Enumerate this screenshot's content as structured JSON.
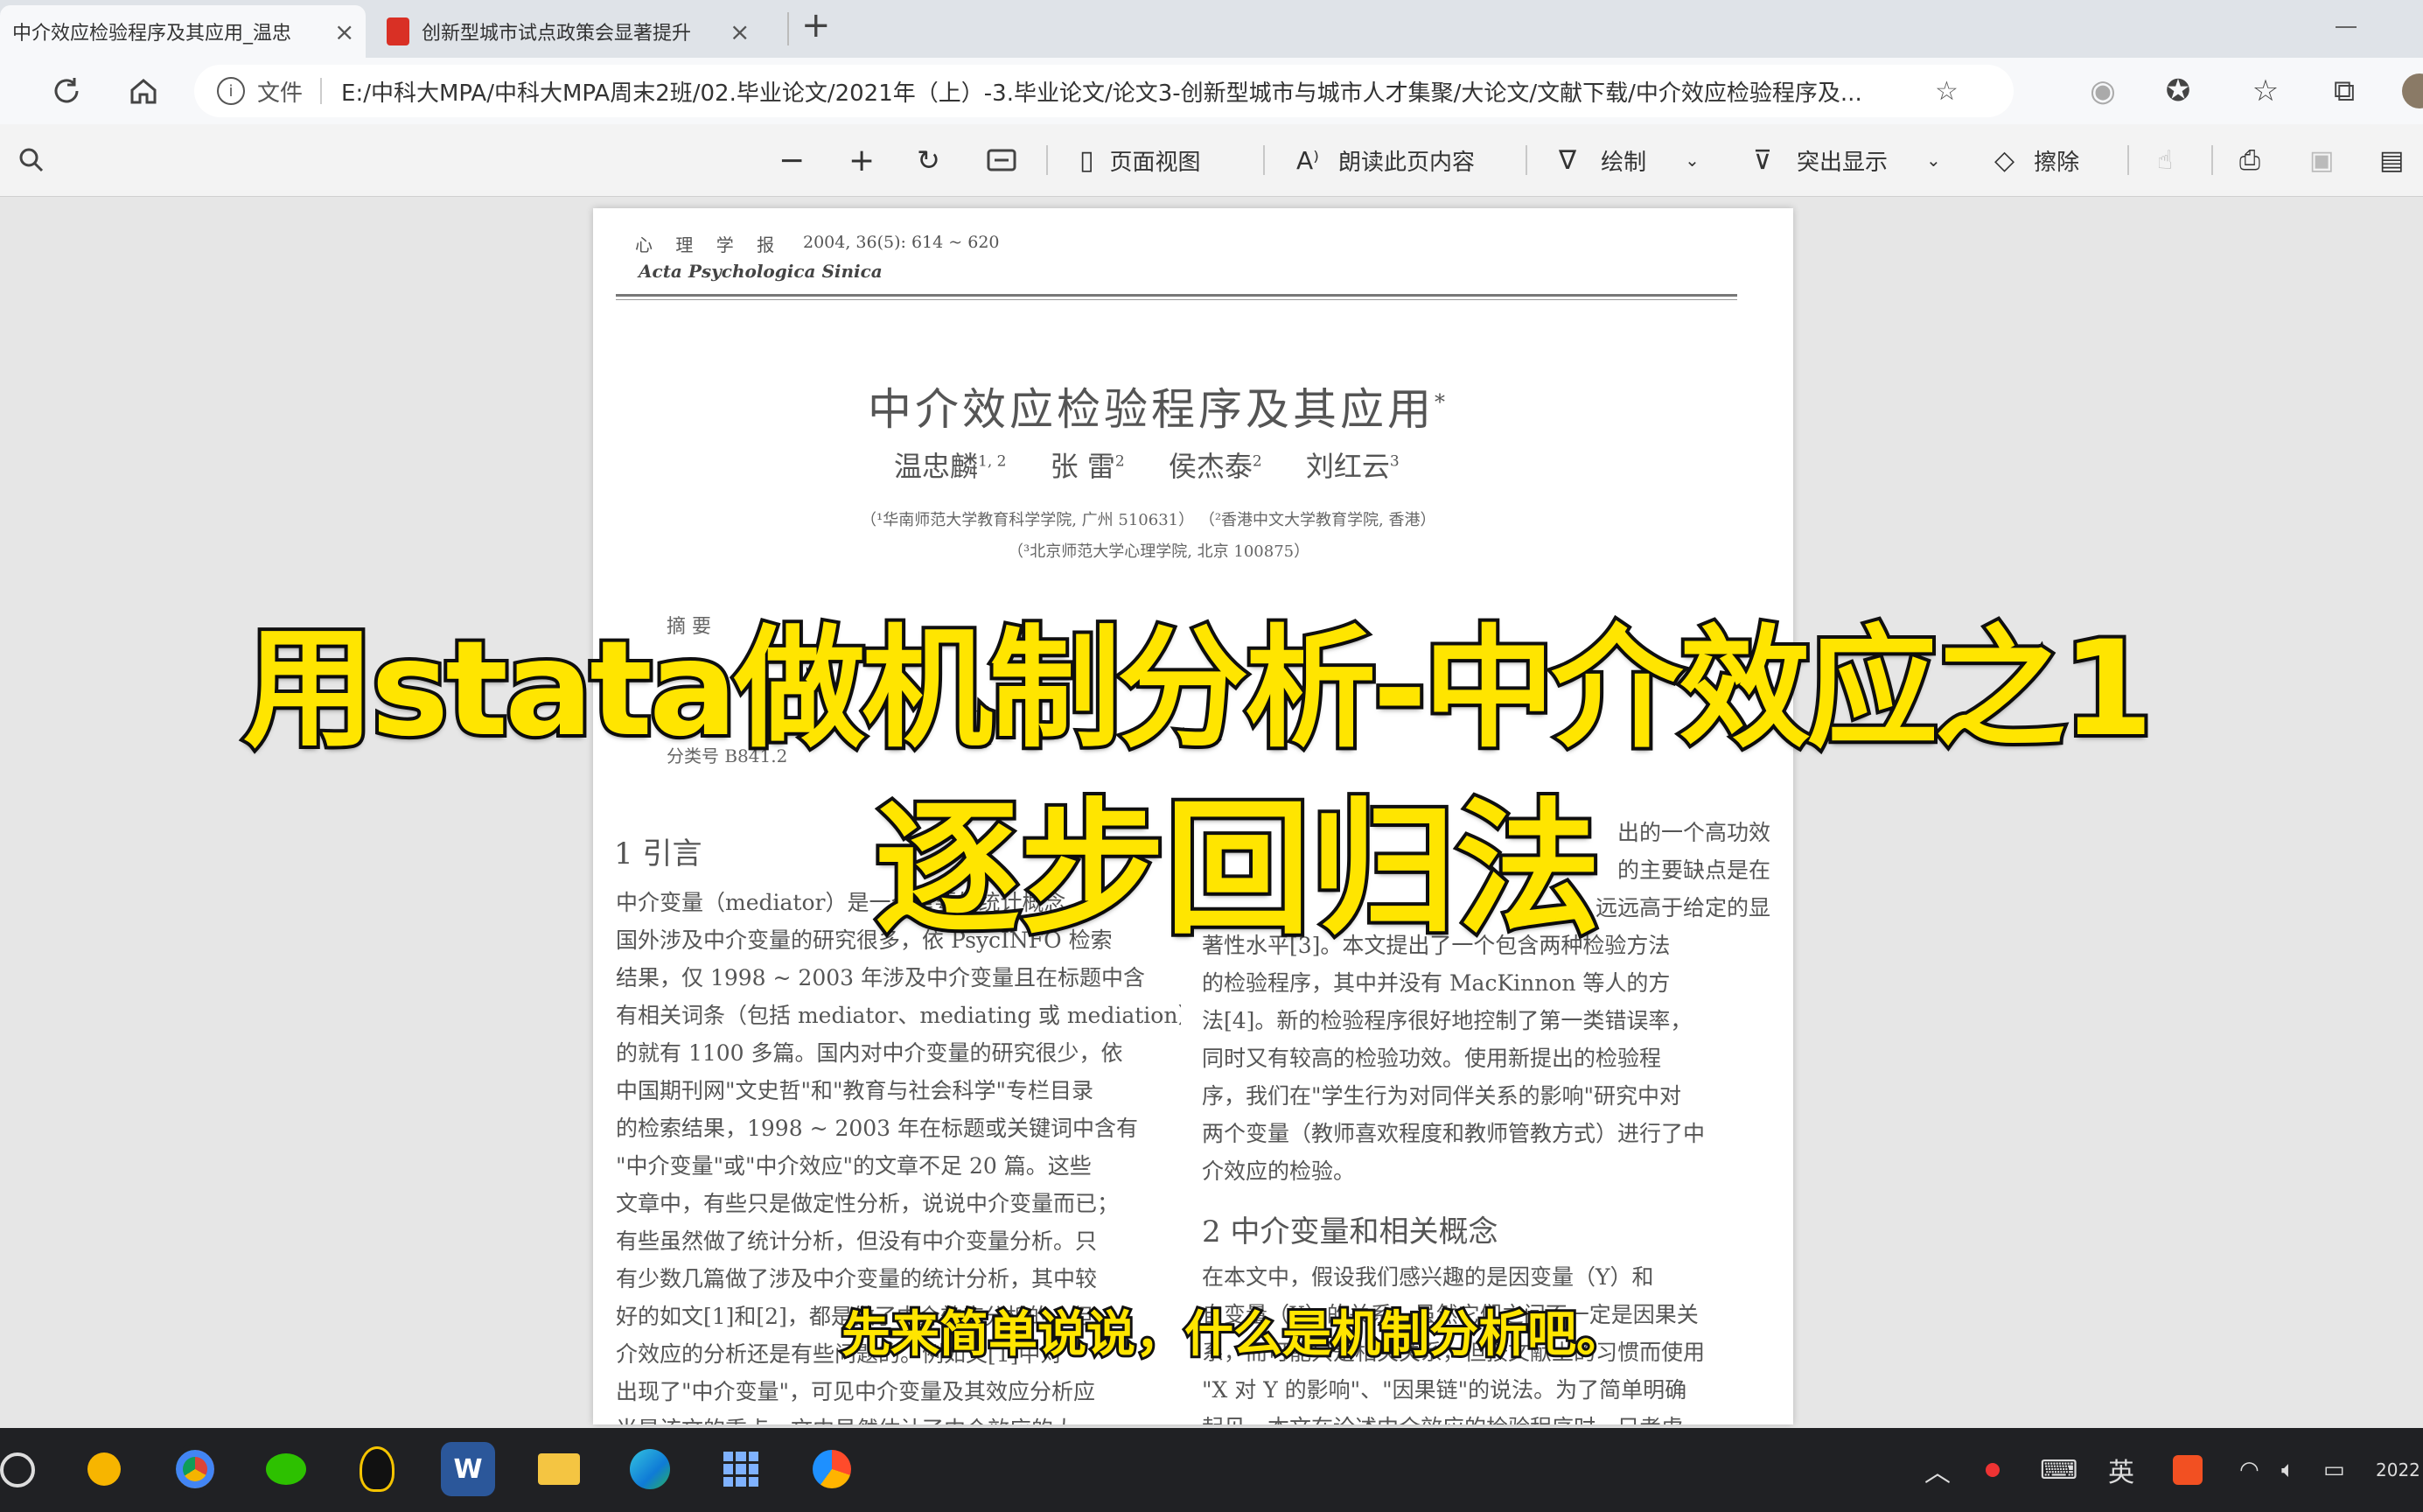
{
  "tabs": [
    {
      "title": "中介效应检验程序及其应用_温忠",
      "close": "×"
    },
    {
      "title": "创新型城市试点政策会显著提升",
      "close": "×"
    }
  ],
  "new_tab": "+",
  "address": {
    "info_label": "文件",
    "url": "E:/中科大MPA/中科大MPA周末2班/02.毕业论文/2021年（上）-3.毕业论文/论文3-创新型城市与城市人才集聚/大论文/文献下载/中介效应检验程序及..."
  },
  "pdf_toolbar": {
    "page_view": "页面视图",
    "read_aloud": "朗读此页内容",
    "draw": "绘制",
    "highlight": "突出显示",
    "erase": "擦除"
  },
  "paper": {
    "journal_cn": "心 理 学 报",
    "volume": "2004, 36(5): 614 ~ 620",
    "journal_en": "Acta Psychologica Sinica",
    "title": "中介效应检验程序及其应用",
    "title_mark": "*",
    "authors": [
      {
        "name": "温忠麟",
        "sup": "1, 2"
      },
      {
        "name": "张  雷",
        "sup": "2"
      },
      {
        "name": "侯杰泰",
        "sup": "2"
      },
      {
        "name": "刘红云",
        "sup": "3"
      }
    ],
    "affil1": "（¹华南师范大学教育科学学院, 广州 510631） （²香港中文大学教育学院, 香港）",
    "affil2": "（³北京师范大学心理学院, 北京 100875）",
    "abstract_label": "摘  要",
    "classification": "分类号    B841.2",
    "section1_heading": "1   引言",
    "section2_heading": "2   中介变量和相关概念",
    "left_lines": [
      "    中介变量（mediator）是一个重要的统计概念，",
      "国外涉及中介变量的研究很多，依 PsycINFO 检索",
      "结果，仅 1998 ~ 2003 年涉及中介变量且在标题中含",
      "有相关词条（包括 mediator、mediating 或 mediation）",
      "的就有 1100 多篇。国内对中介变量的研究很少，依",
      "中国期刊网\"文史哲\"和\"教育与社会科学\"专栏目录",
      "的检索结果，1998 ~ 2003 年在标题或关键词中含有",
      "\"中介变量\"或\"中介效应\"的文章不足 20 篇。这些",
      "文章中，有些只是做定性分析，说说中介变量而已；",
      "有些虽然做了统计分析，但没有中介变量分析。只",
      "有少数几篇做了涉及中介变量的统计分析，其中较",
      "好的如文[1]和[2]，都是做了中介效应分析的，但",
      "介效应的分析还是有些问题的。例如文[1]中对",
      "出现了\"中介变量\"，可见中介变量及其效应分析应",
      "当是该文的重点。文中虽然估计了中介效应的大"
    ],
    "right_lines_top": [
      "出的一个高功效",
      "的主要缺点是在",
      "远远高于给定的显",
      "著性水平[3]。本文提出了一个包含两种检验方法",
      "的检验程序，其中并没有 MacKinnon 等人的方",
      "法[4]。新的检验程序很好地控制了第一类错误率，",
      "同时又有较高的检验功效。使用新提出的检验程",
      "序，我们在\"学生行为对同伴关系的影响\"研究中对",
      "两个变量（教师喜欢程度和教师管教方式）进行了中",
      "介效应的检验。"
    ],
    "right_lines_bottom": [
      "    在本文中，假设我们感兴趣的是因变量（Y）和",
      "自变量（X）的关系，虽然它们之间不一定是因果关",
      "系，而可能只是相关关系，但按文献上的习惯而使用",
      "\"X 对 Y 的影响\"、\"因果链\"的说法。为了简单明确",
      "起见，本文在论述中介效应的检验程序时，只考虑"
    ]
  },
  "overlay": {
    "title_line1": "用stata做机制分析-中介效应之1",
    "title_line2": "逐步回归法",
    "subtitle": "先来简单说说，什么是机制分析吧。"
  },
  "taskbar": {
    "ime": "英",
    "clock": "2022"
  },
  "colors": {
    "overlay_fill": "#ffe500",
    "overlay_stroke": "#111111",
    "taskbar": "#202124"
  }
}
